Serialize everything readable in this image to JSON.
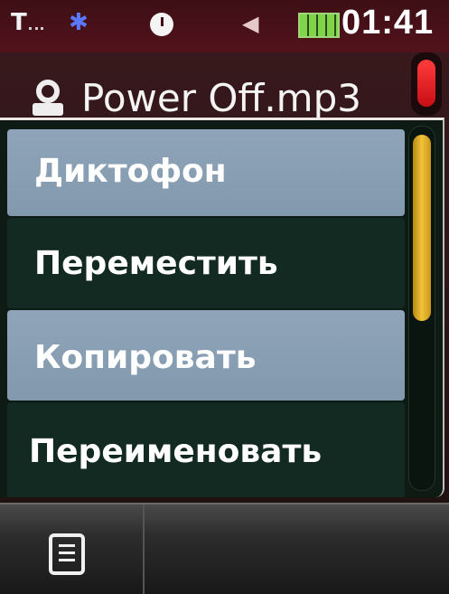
{
  "status_bar": {
    "signal_glyph": "T",
    "bluetooth_glyph": "✱",
    "mute_glyph": "◀",
    "battery_color": "#7fd44a",
    "time": "01:41"
  },
  "file": {
    "name": "Power Off.mp3",
    "icon": "voice-recorder-icon"
  },
  "menu": {
    "items": [
      {
        "label": "Диктофон",
        "style": "light"
      },
      {
        "label": "Переместить",
        "style": "dark"
      },
      {
        "label": "Копировать",
        "style": "light"
      },
      {
        "label": "Переименовать",
        "style": "dark"
      }
    ],
    "scrollbar_color": "#f2c23a"
  },
  "top_scrollbar_color": "#e0181e",
  "softkeys": {
    "left_icon": "document-list-icon"
  }
}
